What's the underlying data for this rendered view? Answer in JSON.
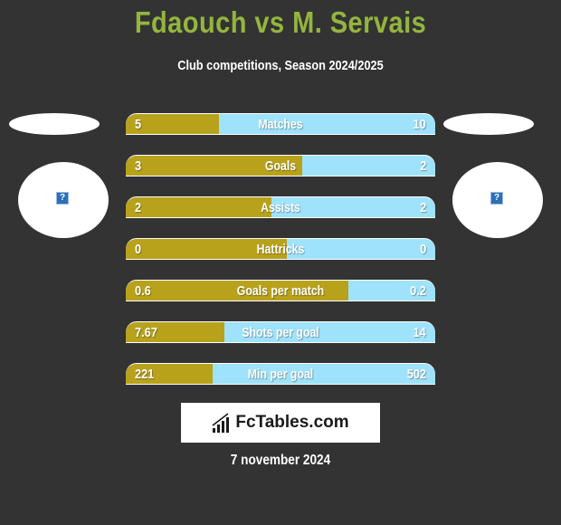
{
  "header": {
    "title": "Fdaouch vs M. Servais",
    "subtitle": "Club competitions, Season 2024/2025"
  },
  "players": {
    "left": {
      "avatar_icon": "question-mark-icon",
      "avatar_glyph": "?"
    },
    "right": {
      "avatar_icon": "question-mark-icon",
      "avatar_glyph": "?"
    }
  },
  "colors": {
    "title": "#94b53e",
    "left_bar": "#b8a21c",
    "right_bar": "#9fe2fb",
    "background": "#333333"
  },
  "stats": [
    {
      "label": "Matches",
      "left": "5",
      "right": "10",
      "left_share": 0.3
    },
    {
      "label": "Goals",
      "left": "3",
      "right": "2",
      "left_share": 0.57
    },
    {
      "label": "Assists",
      "left": "2",
      "right": "2",
      "left_share": 0.47
    },
    {
      "label": "Hattricks",
      "left": "0",
      "right": "0",
      "left_share": 0.52
    },
    {
      "label": "Goals per match",
      "left": "0.6",
      "right": "0.2",
      "left_share": 0.72
    },
    {
      "label": "Shots per goal",
      "left": "7.67",
      "right": "14",
      "left_share": 0.32
    },
    {
      "label": "Min per goal",
      "left": "221",
      "right": "502",
      "left_share": 0.28
    }
  ],
  "footer": {
    "logo_text": "FcTables.com",
    "date": "7 november 2024"
  }
}
